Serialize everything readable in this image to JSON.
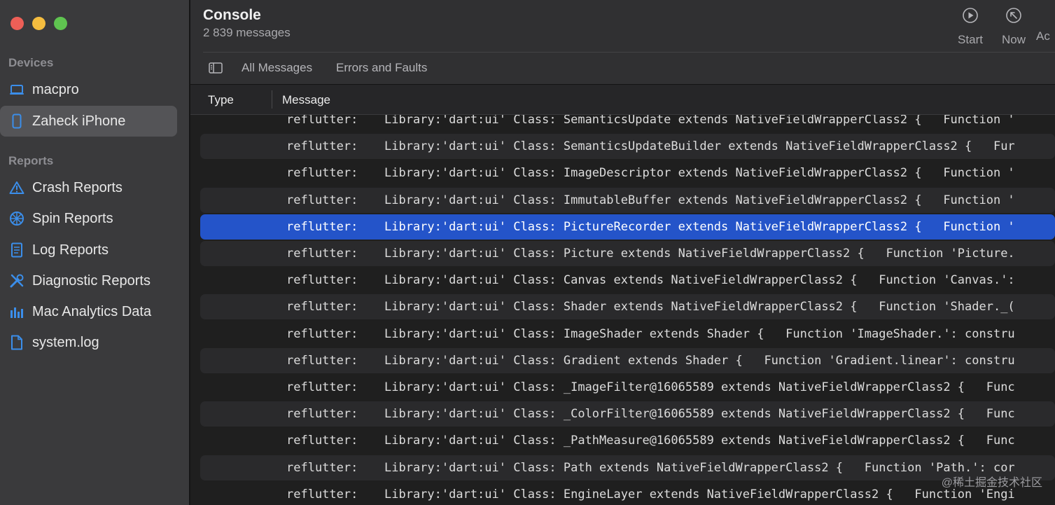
{
  "window": {
    "title": "Console",
    "subtitle": "2 839 messages"
  },
  "sidebar": {
    "devices_header": "Devices",
    "devices": [
      {
        "label": "macpro",
        "icon": "laptop-icon",
        "selected": false
      },
      {
        "label": "Zaheck iPhone",
        "icon": "iphone-icon",
        "selected": true
      }
    ],
    "reports_header": "Reports",
    "reports": [
      {
        "label": "Crash Reports",
        "icon": "warning-icon"
      },
      {
        "label": "Spin Reports",
        "icon": "spin-icon"
      },
      {
        "label": "Log Reports",
        "icon": "document-icon"
      },
      {
        "label": "Diagnostic Reports",
        "icon": "tools-icon"
      },
      {
        "label": "Mac Analytics Data",
        "icon": "bar-chart-icon"
      },
      {
        "label": "system.log",
        "icon": "file-icon"
      }
    ]
  },
  "toolbar": {
    "start_label": "Start",
    "now_label": "Now",
    "actions_label": "Ac"
  },
  "filters": {
    "all_messages": "All Messages",
    "errors_and_faults": "Errors and Faults"
  },
  "columns": {
    "type": "Type",
    "message": "Message"
  },
  "rows": [
    {
      "prefix": "reflutter:",
      "text": "Library:'dart:ui' Class: SemanticsUpdate extends NativeFieldWrapperClass2 {   Function '"
    },
    {
      "prefix": "reflutter:",
      "text": "Library:'dart:ui' Class: SemanticsUpdateBuilder extends NativeFieldWrapperClass2 {   Fur"
    },
    {
      "prefix": "reflutter:",
      "text": "Library:'dart:ui' Class: ImageDescriptor extends NativeFieldWrapperClass2 {   Function '"
    },
    {
      "prefix": "reflutter:",
      "text": "Library:'dart:ui' Class: ImmutableBuffer extends NativeFieldWrapperClass2 {   Function '"
    },
    {
      "prefix": "reflutter:",
      "text": "Library:'dart:ui' Class: PictureRecorder extends NativeFieldWrapperClass2 {   Function '"
    },
    {
      "prefix": "reflutter:",
      "text": "Library:'dart:ui' Class: Picture extends NativeFieldWrapperClass2 {   Function 'Picture."
    },
    {
      "prefix": "reflutter:",
      "text": "Library:'dart:ui' Class: Canvas extends NativeFieldWrapperClass2 {   Function 'Canvas.':"
    },
    {
      "prefix": "reflutter:",
      "text": "Library:'dart:ui' Class: Shader extends NativeFieldWrapperClass2 {   Function 'Shader._("
    },
    {
      "prefix": "reflutter:",
      "text": "Library:'dart:ui' Class: ImageShader extends Shader {   Function 'ImageShader.': constru"
    },
    {
      "prefix": "reflutter:",
      "text": "Library:'dart:ui' Class: Gradient extends Shader {   Function 'Gradient.linear': constru"
    },
    {
      "prefix": "reflutter:",
      "text": "Library:'dart:ui' Class: _ImageFilter@16065589 extends NativeFieldWrapperClass2 {   Func"
    },
    {
      "prefix": "reflutter:",
      "text": "Library:'dart:ui' Class: _ColorFilter@16065589 extends NativeFieldWrapperClass2 {   Func"
    },
    {
      "prefix": "reflutter:",
      "text": "Library:'dart:ui' Class: _PathMeasure@16065589 extends NativeFieldWrapperClass2 {   Func"
    },
    {
      "prefix": "reflutter:",
      "text": "Library:'dart:ui' Class: Path extends NativeFieldWrapperClass2 {   Function 'Path.': cor"
    },
    {
      "prefix": "reflutter:",
      "text": "Library:'dart:ui' Class: EngineLayer extends NativeFieldWrapperClass2 {   Function 'Engi"
    }
  ],
  "selected_row": 4,
  "watermark": "@稀土掘金技术社区",
  "colors": {
    "selection": "#2454c9",
    "sidebar_bg": "#3a3a3c",
    "main_bg": "#1f1f1f"
  }
}
